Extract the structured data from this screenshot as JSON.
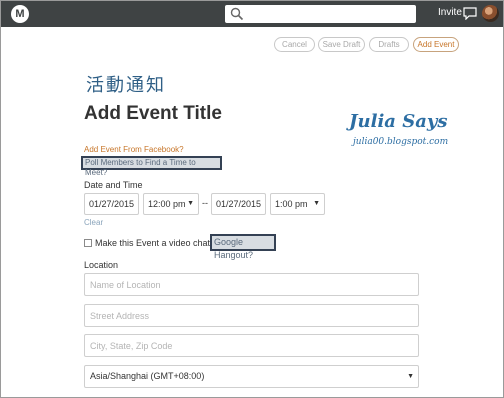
{
  "header": {
    "logo_letter": "M",
    "search_placeholder": "",
    "invite_label": "Invite",
    "icons": [
      "search-icon",
      "chat-icon"
    ],
    "bar_color": "#3f4344"
  },
  "actions": {
    "cancel_label": "Cancel",
    "save_draft_label": "Save Draft",
    "drafts_label": "Drafts",
    "add_event_label": "Add Event",
    "accent_color": "#c7762a"
  },
  "chinese_title": "活動通知",
  "event_title": "Add Event Title",
  "watermark": {
    "name": "Julia Says",
    "url": "julia00.blogspot.com"
  },
  "facebook_link": "Add Event From Facebook?",
  "poll_link": "Poll Members to Find a Time to Meet?",
  "date_time": {
    "label": "Date and Time",
    "start_date": "01/27/2015",
    "start_time": "12:00 pm",
    "separator": "--",
    "end_date": "01/27/2015",
    "end_time": "1:00 pm",
    "clear_label": "Clear"
  },
  "video_chat": {
    "label": "Make this Event a video chat with",
    "hangout_label": "Google Hangout?",
    "checked": false
  },
  "location": {
    "label": "Location",
    "name_placeholder": "Name of Location",
    "street_placeholder": "Street Address",
    "city_placeholder": "City, State, Zip Code",
    "timezone": "Asia/Shanghai (GMT+08:00)"
  }
}
